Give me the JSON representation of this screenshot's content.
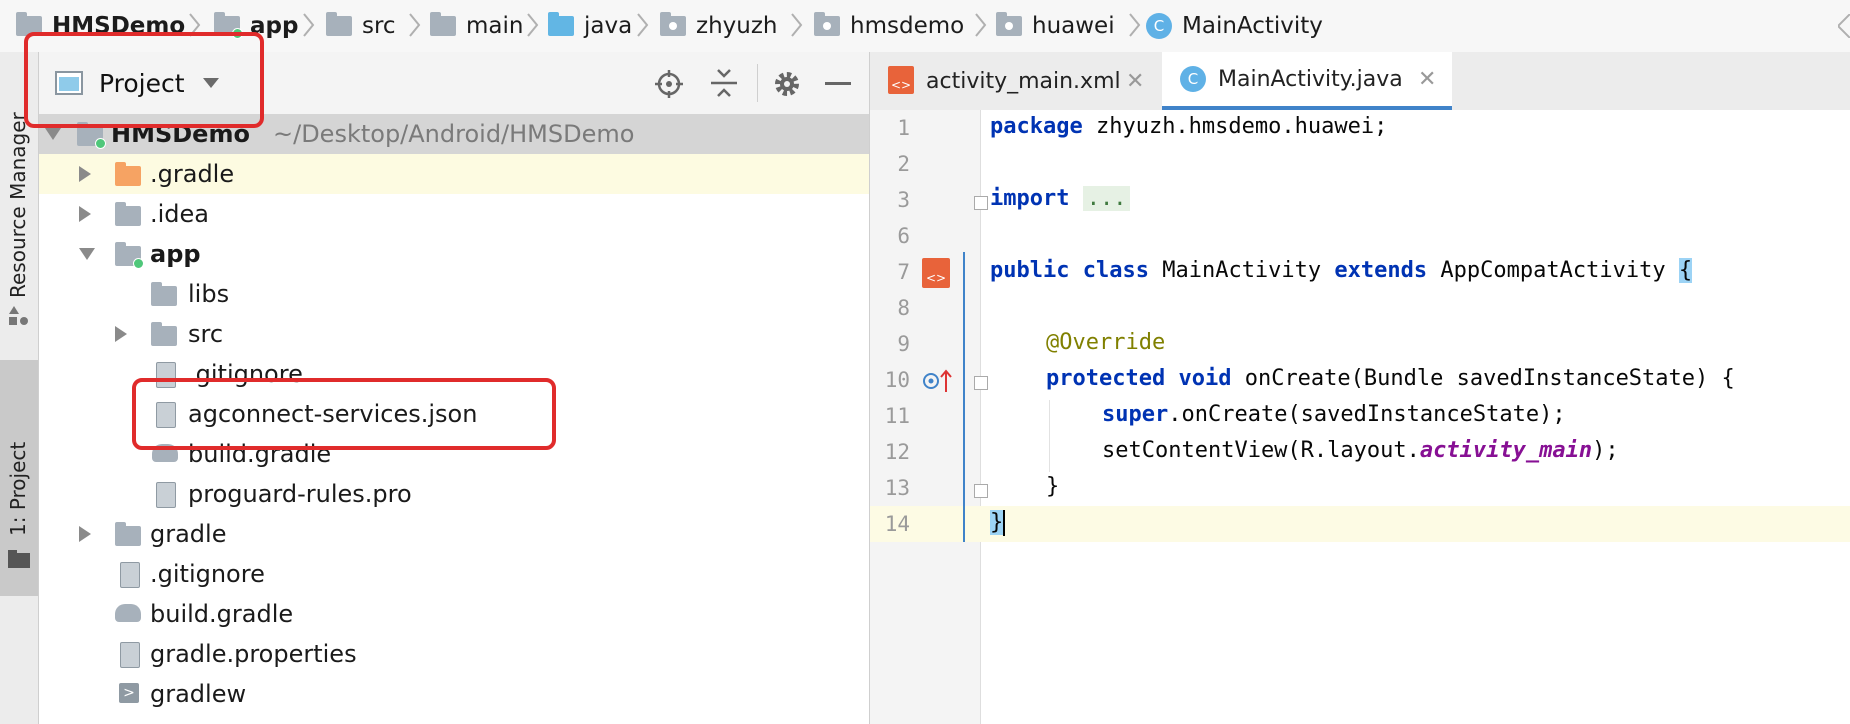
{
  "breadcrumb": [
    {
      "label": "HMSDemo",
      "icon": "folder-icon"
    },
    {
      "label": "app",
      "icon": "module-folder-icon"
    },
    {
      "label": "src",
      "icon": "folder-icon"
    },
    {
      "label": "main",
      "icon": "folder-icon"
    },
    {
      "label": "java",
      "icon": "source-folder-icon"
    },
    {
      "label": "zhyuzh",
      "icon": "package-icon"
    },
    {
      "label": "hmsdemo",
      "icon": "package-icon"
    },
    {
      "label": "huawei",
      "icon": "package-icon"
    },
    {
      "label": "MainActivity",
      "icon": "class-icon"
    }
  ],
  "side_stripe": {
    "resource_manager": "Resource Manager",
    "project_tab": "1: Project"
  },
  "panel": {
    "view_selector": "Project",
    "root_name": "HMSDemo",
    "root_path": "~/Desktop/Android/HMSDemo"
  },
  "tree": [
    {
      "label": ".gradle"
    },
    {
      "label": ".idea"
    },
    {
      "label": "app"
    },
    {
      "label": "libs"
    },
    {
      "label": "src"
    },
    {
      "label": ".gitignore"
    },
    {
      "label": "agconnect-services.json"
    },
    {
      "label": "build.gradle"
    },
    {
      "label": "proguard-rules.pro"
    },
    {
      "label": "gradle"
    },
    {
      "label": ".gitignore"
    },
    {
      "label": "build.gradle"
    },
    {
      "label": "gradle.properties"
    },
    {
      "label": "gradlew"
    }
  ],
  "tabs": [
    {
      "label": "activity_main.xml",
      "active": false
    },
    {
      "label": "MainActivity.java",
      "active": true
    }
  ],
  "code": {
    "line_numbers": [
      "1",
      "2",
      "3",
      "6",
      "7",
      "8",
      "9",
      "10",
      "11",
      "12",
      "13",
      "14"
    ],
    "l1_kw": "package",
    "l1_rest": " zhyuzh.hmsdemo.huawei;",
    "l3_kw": "import",
    "l3_rest": "...",
    "l7_kw1": "public",
    "l7_kw2": "class",
    "l7_name": "MainActivity",
    "l7_kw3": "extends",
    "l7_parent": "AppCompatActivity",
    "l7_brace": "{",
    "l9_ann": "@Override",
    "l10_kw1": "protected",
    "l10_kw2": "void",
    "l10_rest": "onCreate(Bundle savedInstanceState) {",
    "l11_kw": "super",
    "l11_rest": ".onCreate(savedInstanceState);",
    "l12_pre": "setContentView(R.layout.",
    "l12_field": "activity_main",
    "l12_post": ");",
    "l13": "}",
    "l14": "}"
  },
  "colors": {
    "highlight_box": "#e02b2b",
    "keyword": "#0033b3",
    "annotation": "#808000",
    "field": "#871094"
  }
}
